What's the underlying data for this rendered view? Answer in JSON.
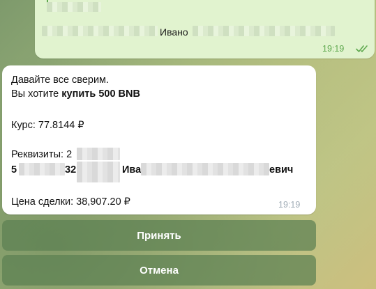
{
  "outgoing_message": {
    "name_partial": "Ивано",
    "time": "19:19",
    "status_icon": "double-check-icon"
  },
  "incoming_message": {
    "greeting": "Давайте все сверим.",
    "buy_prefix": "Вы хотите ",
    "buy_bold": "купить 500 BNB",
    "rate": "Курс: 77.8144 ₽",
    "details_label": "Реквизиты: 2",
    "account_start": "5",
    "account_mid": "32",
    "holder_first": "Ива",
    "holder_end": "евич",
    "price": "Цена сделки: 38,907.20 ₽",
    "time": "19:19"
  },
  "keyboard": {
    "accept_label": "Принять",
    "cancel_label": "Отмена"
  },
  "colors": {
    "outgoing_bubble": "#e1f3cf",
    "incoming_bubble": "#ffffff",
    "accent_green": "#5fa94f",
    "button_bg": "#5c8052"
  }
}
